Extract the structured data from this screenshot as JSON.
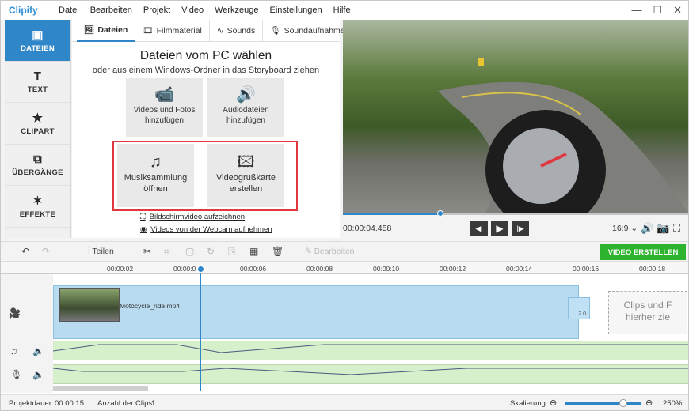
{
  "app": {
    "logo": "Clipify"
  },
  "menu": [
    "Datei",
    "Bearbeiten",
    "Projekt",
    "Video",
    "Werkzeuge",
    "Einstellungen",
    "Hilfe"
  ],
  "window_controls": {
    "minimize": "—",
    "maximize": "☐",
    "close": "✕"
  },
  "sidebar": [
    {
      "label": "DATEIEN",
      "icon": "image-icon",
      "glyph": "▣",
      "active": true
    },
    {
      "label": "TEXT",
      "icon": "text-icon",
      "glyph": "T",
      "active": false
    },
    {
      "label": "CLIPART",
      "icon": "star-icon",
      "glyph": "★",
      "active": false
    },
    {
      "label": "ÜBERGÄNGE",
      "icon": "layers-icon",
      "glyph": "⧉",
      "active": false
    },
    {
      "label": "EFFEKTE",
      "icon": "magic-wand-icon",
      "glyph": "✶",
      "active": false
    }
  ],
  "tabs": [
    {
      "label": "Dateien",
      "glyph": "🖼",
      "active": true
    },
    {
      "label": "Filmmaterial",
      "glyph": "🎞",
      "active": false
    },
    {
      "label": "Sounds",
      "glyph": "∿",
      "active": false
    },
    {
      "label": "Soundaufnahme",
      "glyph": "🎙",
      "active": false
    }
  ],
  "panel": {
    "title": "Dateien vom PC wählen",
    "subtitle": "oder aus einem Windows-Ordner in das Storyboard ziehen",
    "tiles": [
      {
        "label": "Videos und Fotos hinzufügen",
        "icon": "film-camera-icon",
        "glyph": "📹"
      },
      {
        "label": "Audiodateien hinzufügen",
        "icon": "audio-file-icon",
        "glyph": "🔊"
      },
      {
        "label": "Musiksammlung öffnen",
        "icon": "music-notes-icon",
        "glyph": "♫"
      },
      {
        "label": "Videogrußkarte erstellen",
        "icon": "video-card-icon",
        "glyph": "🖾"
      }
    ],
    "links": [
      {
        "label": "Bildschirmvideo aufzeichnen",
        "glyph": "⛶"
      },
      {
        "label": "Videos von der Webcam aufnehmen",
        "glyph": "◉"
      }
    ]
  },
  "player": {
    "time": "00:00:04.458",
    "progress": 0.284,
    "ratio": "16:9 ⌄"
  },
  "toolbar": {
    "split_label": "Teilen",
    "edit_label": "Bearbeiten",
    "create_label": "VIDEO ERSTELLEN"
  },
  "timeline": {
    "ticks": [
      "00:00:02",
      "00:00:04",
      "00:00:06",
      "00:00:08",
      "00:00:10",
      "00:00:12",
      "00:00:14",
      "00:00:16",
      "00:00:18"
    ],
    "clip_name": "Motocycle_ride.mp4",
    "transition_label": "2.0",
    "dropzone": "Clips und F hierher zie"
  },
  "status": {
    "duration_label": "Projektdauer:",
    "duration": "00:00:15",
    "clips_label": "Anzahl der Clips:",
    "clips": "1",
    "zoom_label": "Skalierung:",
    "zoom": "250%",
    "zoom_level": 0.72
  }
}
